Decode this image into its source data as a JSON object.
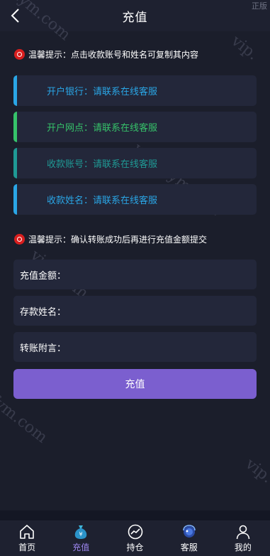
{
  "header": {
    "title": "充值",
    "corner_tag": "正版"
  },
  "watermarks": [
    "vip.9fym.com",
    "vip.9fym.com",
    "vip.9fym.com",
    "vip.9fym.com",
    "vip.",
    "vip."
  ],
  "tip1": {
    "text": "温馨提示：点击收款账号和姓名可复制其内容"
  },
  "info_cards": [
    {
      "label": "开户银行：",
      "value": "请联系在线客服",
      "color": "#2aa6e6"
    },
    {
      "label": "开户网点：",
      "value": "请联系在线客服",
      "color": "#36c36a"
    },
    {
      "label": "收款账号：",
      "value": "请联系在线客服",
      "color": "#1f9a95"
    },
    {
      "label": "收款姓名：",
      "value": "请联系在线客服",
      "color": "#2aa6e6"
    }
  ],
  "tip2": {
    "text": "温馨提示：确认转账成功后再进行充值金额提交"
  },
  "form": {
    "amount_label": "充值金额：",
    "amount_value": "",
    "name_label": "存款姓名：",
    "name_value": "",
    "note_label": "转账附言：",
    "note_value": ""
  },
  "submit_label": "充值",
  "tabs": [
    {
      "label": "首页",
      "icon": "home-icon",
      "active": false
    },
    {
      "label": "充值",
      "icon": "money-bag-icon",
      "active": true
    },
    {
      "label": "持仓",
      "icon": "chart-icon",
      "active": false
    },
    {
      "label": "客服",
      "icon": "support-icon",
      "active": false
    },
    {
      "label": "我的",
      "icon": "user-icon",
      "active": false
    }
  ],
  "colors": {
    "accent": "#7b5fcf",
    "background": "#1b1e2b",
    "card": "#23273a",
    "tip_icon": "#d81e1e"
  }
}
